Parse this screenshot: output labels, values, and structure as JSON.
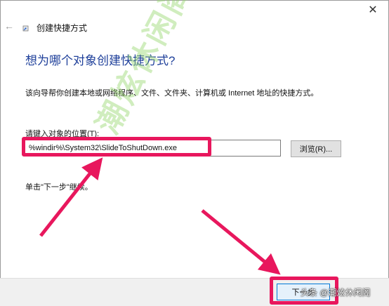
{
  "window": {
    "close_glyph": "✕",
    "back_glyph": "←",
    "title": "创建快捷方式"
  },
  "main": {
    "heading": "想为哪个对象创建快捷方式?",
    "description": "该向导帮你创建本地或网络程序、文件、文件夹、计算机或 Internet 地址的快捷方式。",
    "location_label": "请键入对象的位置(T):",
    "location_value": "%windir%\\System32\\SlideToShutDown.exe",
    "browse_label": "浏览(R)...",
    "hint": "单击\"下一步\"继续。"
  },
  "footer": {
    "next_label": "下一步"
  },
  "overlay": {
    "watermark": "潮炫休闲阁",
    "credit": "头条 @潮炫休闲阁",
    "highlight_color": "#e8175d"
  },
  "icons": [
    "close-icon",
    "back-arrow-icon",
    "shortcut-wizard-icon"
  ]
}
